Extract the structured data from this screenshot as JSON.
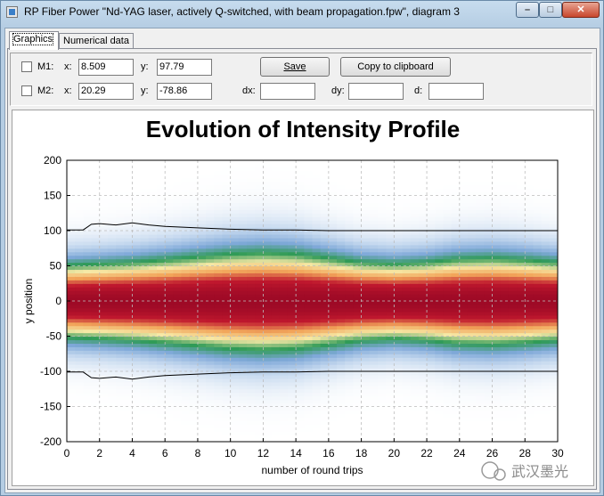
{
  "window": {
    "title": "RP Fiber Power \"Nd-YAG laser, actively Q-switched, with beam propagation.fpw\", diagram 3",
    "minimize": "–",
    "maximize": "□",
    "close": "✕"
  },
  "tabs": [
    {
      "label": "Graphics",
      "active": true
    },
    {
      "label": "Numerical data",
      "active": false
    }
  ],
  "controls": {
    "m1": {
      "label": "M1:",
      "x_label": "x:",
      "x_value": "8.509",
      "y_label": "y:",
      "y_value": "97.79"
    },
    "m2": {
      "label": "M2:",
      "x_label": "x:",
      "x_value": "20.29",
      "y_label": "y:",
      "y_value": "-78.86"
    },
    "dx_label": "dx:",
    "dx_value": "",
    "dy_label": "dy:",
    "dy_value": "",
    "d_label": "d:",
    "d_value": "",
    "save_label": "Save",
    "copy_label": "Copy to clipboard"
  },
  "chart_data": {
    "type": "heatmap",
    "title": "Evolution of Intensity Profile",
    "xlabel": "number of round trips",
    "ylabel": "y position",
    "xlim": [
      0,
      30
    ],
    "ylim": [
      -200,
      200
    ],
    "x_ticks": [
      "0",
      "2",
      "4",
      "6",
      "8",
      "10",
      "12",
      "14",
      "16",
      "18",
      "20",
      "22",
      "24",
      "26",
      "28",
      "30"
    ],
    "y_ticks": [
      "200",
      "150",
      "100",
      "50",
      "0",
      "-50",
      "-100",
      "-150",
      "-200"
    ],
    "grid": true,
    "colormap": [
      "#ffffff",
      "#c6d9ef",
      "#7ea8d8",
      "#2e9a56",
      "#f6e9a6",
      "#f2a55a",
      "#c0182e",
      "#9e0a26"
    ],
    "beam_radius_series": {
      "x": [
        0,
        1,
        1.5,
        2,
        3,
        4,
        5,
        6,
        8,
        10,
        12,
        14,
        16,
        18,
        20,
        22,
        24,
        26,
        28,
        30
      ],
      "values": [
        101,
        101,
        109,
        110,
        108,
        111,
        108,
        106,
        104,
        102,
        101,
        101,
        100,
        100,
        100,
        100,
        100,
        100,
        100,
        100
      ]
    },
    "core_width_profile": {
      "x": [
        0,
        2,
        4,
        6,
        8,
        10,
        12,
        14,
        16,
        18,
        20,
        22,
        24,
        26,
        28,
        30
      ],
      "relative_width": [
        0.85,
        0.88,
        0.92,
        0.98,
        1.05,
        1.12,
        1.15,
        1.12,
        1.02,
        0.92,
        0.88,
        0.92,
        1.0,
        1.02,
        0.98,
        0.92
      ]
    }
  },
  "watermark": {
    "text": "武汉墨光"
  }
}
